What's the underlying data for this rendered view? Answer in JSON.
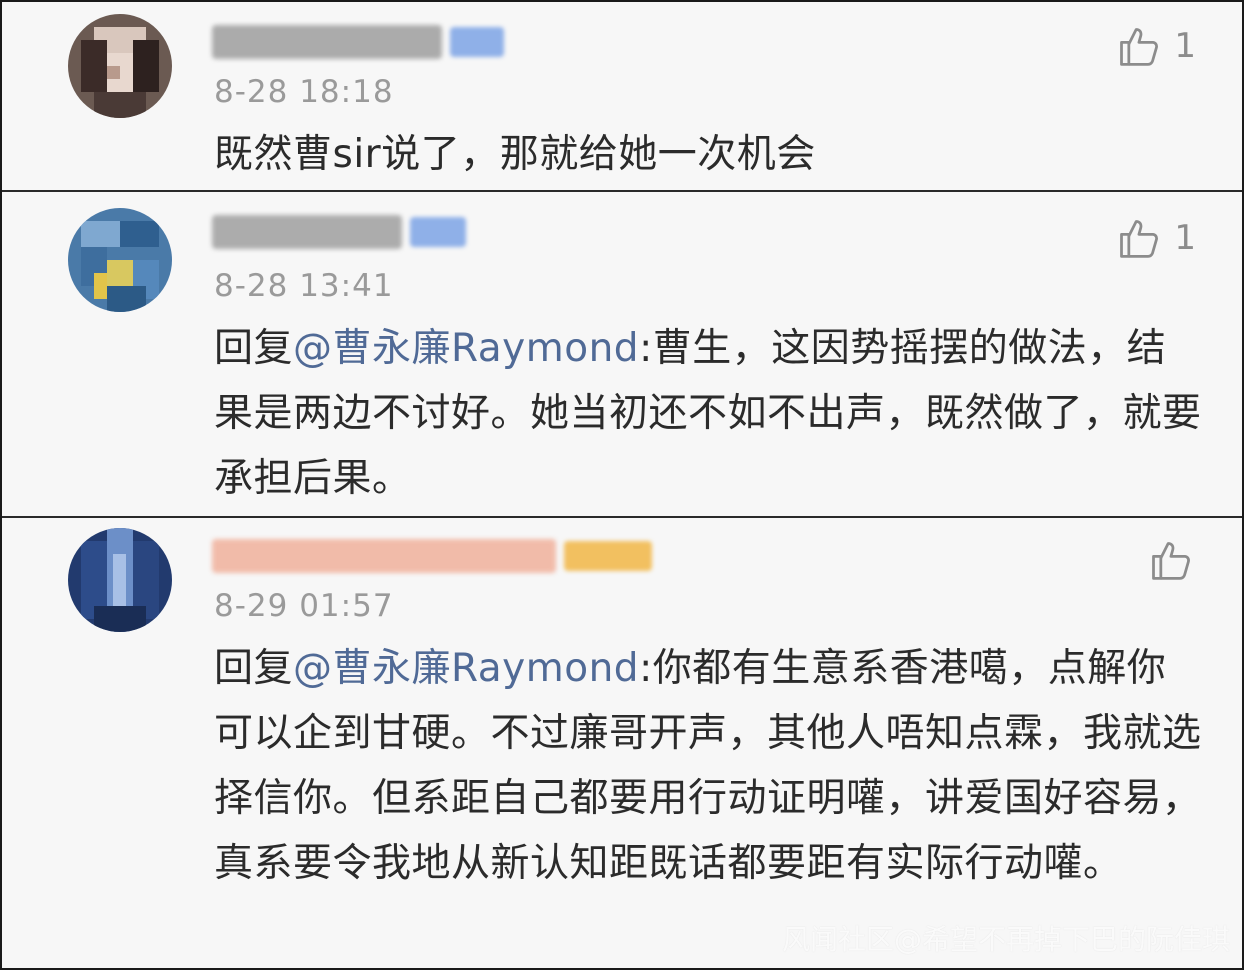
{
  "comments": [
    {
      "time": "8-28 18:18",
      "likes": "1",
      "text": "既然曹sir说了，那就给她一次机会",
      "reply_prefix": "",
      "mention": "",
      "reply_body": "",
      "name_color": "#7a7a7a",
      "badge_color": "#8fb0e8"
    },
    {
      "time": "8-28 13:41",
      "likes": "1",
      "text": "",
      "reply_prefix": "回复",
      "mention": "@曹永廉Raymond",
      "reply_body": ":曹生，这因势摇摆的做法，结果是两边不讨好。她当初还不如不出声，既然做了，就要承担后果。",
      "name_color": "#777777",
      "badge_color": "#8fb0e8"
    },
    {
      "time": "8-29 01:57",
      "likes": "",
      "text": "",
      "reply_prefix": "回复",
      "mention": "@曹永廉Raymond",
      "reply_body": ":你都有生意系香港噶，点解你可以企到甘硬。不过廉哥开声，其他人唔知点霖，我就选择信你。但系距自己都要用行动证明嚾，讲爱国好容易，真系要令我地从新认知距既话都要距有实际行动嚾。",
      "name_color": "#f0a890",
      "badge_color": "#f2c060"
    }
  ],
  "watermark": "风闻社区@希望不再掉下巴的阮佳琪",
  "icons": {
    "like": "thumbs-up-icon"
  },
  "colors": {
    "mention": "#506a96",
    "time": "#9a9a9a",
    "body_text": "#2b2b2b",
    "background": "#f7f7f7"
  }
}
